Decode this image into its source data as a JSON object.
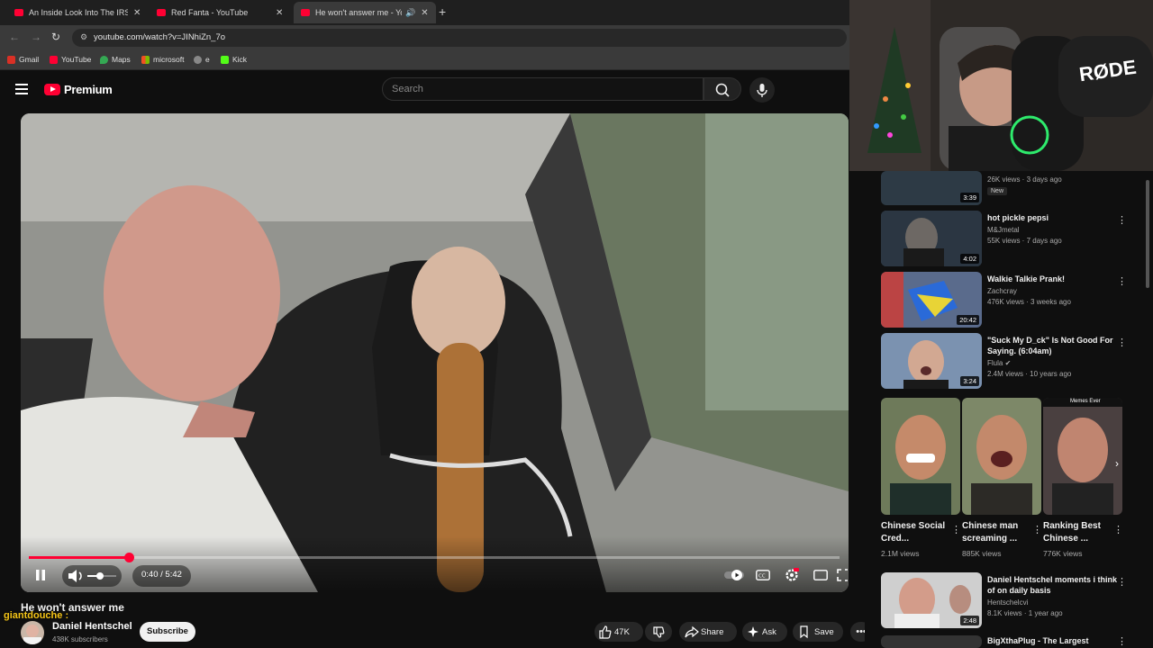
{
  "browser": {
    "tabs": [
      {
        "title": "An Inside Look Into The IRS's C",
        "active": false
      },
      {
        "title": "Red Fanta - YouTube",
        "active": false
      },
      {
        "title": "He won't answer me - YouT",
        "active": true
      }
    ],
    "url": "youtube.com/watch?v=JINhiZn_7o",
    "bookmarks": [
      "Gmail",
      "YouTube",
      "Maps",
      "microsoft",
      "e",
      "Kick"
    ]
  },
  "header": {
    "logo_text": "Premium",
    "search_placeholder": "Search"
  },
  "player": {
    "progress": 0.123,
    "time": "0:40 / 5:42"
  },
  "video": {
    "title": "He won't answer me",
    "channel": "Daniel Hentschel",
    "subscribers": "438K subscribers",
    "subscribe_label": "Subscribe",
    "likes": "47K",
    "share_label": "Share",
    "ask_label": "Ask",
    "save_label": "Save"
  },
  "chat_overlay": "giantdouche :",
  "webcam": {
    "brand": "RØDE"
  },
  "recommendations": [
    {
      "title": "",
      "channel": "",
      "views": "26K views · 3 days ago",
      "badge": "New",
      "duration": "3:39"
    },
    {
      "title": "hot pickle pepsi",
      "channel": "M&Jmetal",
      "views": "55K views · 7 days ago",
      "duration": "4:02"
    },
    {
      "title": "Walkie Talkie Prank!",
      "channel": "Zachcray",
      "views": "476K views · 3 weeks ago",
      "duration": "20:42"
    },
    {
      "title": "\"Suck My D_ck\" Is Not Good For Saying. (6:04am)",
      "channel": "Flula",
      "views": "2.4M views · 10 years ago",
      "duration": "3:24"
    },
    {
      "title": "Daniel Hentschel moments i think of on daily basis",
      "channel": "Hentschelcvi",
      "views": "8.1K views · 1 year ago",
      "duration": "2:48"
    },
    {
      "title": "BigXthaPlug - The Largest",
      "channel": "",
      "views": "",
      "duration": ""
    }
  ],
  "shorts": [
    {
      "title": "Chinese Social Cred...",
      "views": "2.1M views"
    },
    {
      "title": "Chinese man screaming ...",
      "views": "885K views"
    },
    {
      "title": "Ranking Best Chinese ...",
      "views": "776K views"
    }
  ],
  "shorts_overlay_label": "Memes Ever",
  "colors": {
    "accent": "#ff0033",
    "background": "#0f0f0f",
    "pill": "#272727"
  }
}
